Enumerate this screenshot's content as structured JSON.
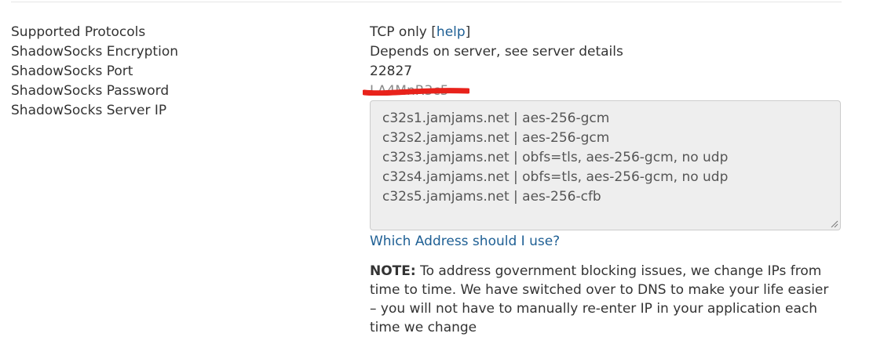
{
  "labels": {
    "protocols": "Supported Protocols",
    "encryption": "ShadowSocks Encryption",
    "port": "ShadowSocks Port",
    "password": "ShadowSocks Password",
    "server_ip": "ShadowSocks Server IP"
  },
  "values": {
    "protocols_text": "TCP only [",
    "protocols_help": "help",
    "protocols_close": "]",
    "encryption": "Depends on server, see server details",
    "port": "22827",
    "password_redacted": "LA4MnR3c5"
  },
  "server_list": [
    "c32s1.jamjams.net | aes-256-gcm",
    "c32s2.jamjams.net | aes-256-gcm",
    "c32s3.jamjams.net | obfs=tls, aes-256-gcm, no udp",
    "c32s4.jamjams.net | obfs=tls, aes-256-gcm, no udp",
    "c32s5.jamjams.net | aes-256-cfb"
  ],
  "which_address_link": "Which Address should I use?",
  "note": {
    "label": "NOTE:",
    "text": " To address government blocking issues, we change IPs from time to time. We have switched over to DNS to make your life easier – you will not have to manually re-enter IP in your application each time we change"
  },
  "colors": {
    "link": "#1e5f94",
    "redaction": "#e8221b",
    "box_bg": "#eeeeee"
  },
  "icons": {
    "resize": "resize-grip-icon"
  }
}
